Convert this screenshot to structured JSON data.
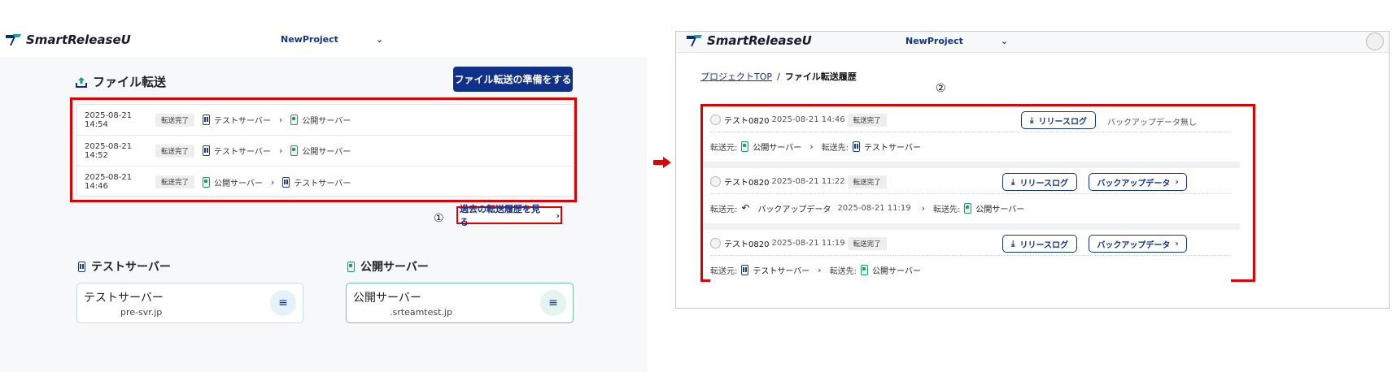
{
  "left": {
    "logo_text": "SmartReleaseU",
    "project_select": "NewProject",
    "section_title": "ファイル転送",
    "prepare_button": "ファイル転送の準備をする",
    "transfers": [
      {
        "date": "2025-08-21 14:54",
        "status": "転送完了",
        "from": "テストサーバー",
        "from_type": "test",
        "to": "公開サーバー",
        "to_type": "pub"
      },
      {
        "date": "2025-08-21 14:52",
        "status": "転送完了",
        "from": "テストサーバー",
        "from_type": "test",
        "to": "公開サーバー",
        "to_type": "pub"
      },
      {
        "date": "2025-08-21 14:46",
        "status": "転送完了",
        "from": "公開サーバー",
        "from_type": "pub",
        "to": "テストサーバー",
        "to_type": "test"
      }
    ],
    "history_link": "過去の転送履歴を見る",
    "history_chevron": "›",
    "marker": "①",
    "servers": [
      {
        "title": "テストサーバー",
        "card_name": "テストサーバー",
        "host": "pre-svr.jp",
        "type": "test"
      },
      {
        "title": "公開サーバー",
        "card_name": "公開サーバー",
        "host": ".srteamtest.jp",
        "type": "pub"
      }
    ],
    "menu_icon": "≡"
  },
  "right": {
    "logo_text": "SmartReleaseU",
    "project_select": "NewProject",
    "breadcrumb": {
      "root": "プロジェクトTOP",
      "separator": "/",
      "current": "ファイル転送履歴"
    },
    "marker": "②",
    "histories": [
      {
        "user": "テスト0820",
        "timestamp": "2025-08-21 14:46",
        "status": "転送完了",
        "release_log": "リリースログ",
        "backup": "バックアップデータ無し",
        "has_backup_button": false,
        "from_label": "転送元:",
        "from": "公開サーバー",
        "from_type": "pub",
        "to_label": "転送先:",
        "to": "テストサーバー",
        "to_type": "test",
        "from_backup_time": ""
      },
      {
        "user": "テスト0820",
        "timestamp": "2025-08-21 11:22",
        "status": "転送完了",
        "release_log": "リリースログ",
        "backup": "バックアップデータ",
        "has_backup_button": true,
        "from_label": "転送元:",
        "from": "バックアップデータ",
        "from_type": "undo",
        "to_label": "転送先:",
        "to": "公開サーバー",
        "to_type": "pub",
        "from_backup_time": "2025-08-21 11:19"
      },
      {
        "user": "テスト0820",
        "timestamp": "2025-08-21 11:19",
        "status": "転送完了",
        "release_log": "リリースログ",
        "backup": "バックアップデータ",
        "has_backup_button": true,
        "from_label": "転送元:",
        "from": "テストサーバー",
        "from_type": "test",
        "to_label": "転送先:",
        "to": "公開サーバー",
        "to_type": "pub",
        "from_backup_time": ""
      }
    ]
  },
  "colors": {
    "primary": "#10318a",
    "highlight": "#e00000",
    "public_server": "#1f9a72",
    "test_server": "#1d3c9a"
  }
}
